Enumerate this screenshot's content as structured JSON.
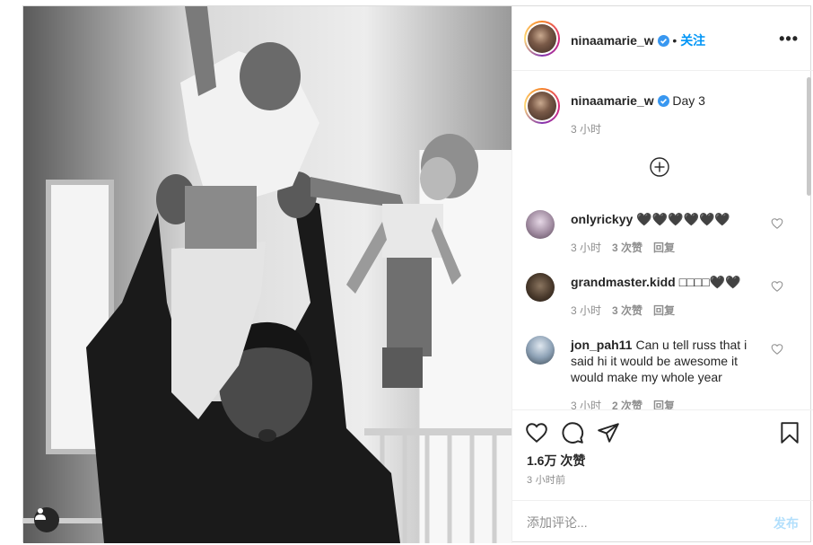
{
  "post": {
    "author": "ninaamarie_w",
    "follow_separator": "•",
    "follow_label": "关注",
    "more_label": "•••"
  },
  "caption": {
    "author": "ninaamarie_w",
    "text": "Day 3",
    "time": "3 小时"
  },
  "comments": [
    {
      "user": "onlyrickyy",
      "text": "🖤🖤🖤🖤🖤🖤",
      "time": "3 小时",
      "likes": "3 次赞",
      "reply": "回复"
    },
    {
      "user": "grandmaster.kidd",
      "text": "□□□□🖤🖤",
      "time": "3 小时",
      "likes": "3 次赞",
      "reply": "回复"
    },
    {
      "user": "jon_pah11",
      "text": "Can u tell russ that i said hi it would be awesome it would make my whole year",
      "time": "3 小时",
      "likes": "2 次赞",
      "reply": "回复"
    }
  ],
  "actions": {
    "likes": "1.6万 次赞",
    "posted_ago": "3 小时前"
  },
  "add_comment": {
    "placeholder": "添加评论...",
    "post_label": "发布"
  },
  "icons": {
    "like": "heart-icon",
    "comment": "comment-bubble-icon",
    "share": "paper-plane-icon",
    "save": "bookmark-icon",
    "tag": "user-tag-icon",
    "load_more": "plus-circle-icon",
    "verified": "verified-badge-icon"
  },
  "colors": {
    "accent": "#0095f6",
    "post_disabled": "#b2dffc",
    "muted": "#8e8e8e",
    "border": "#dbdbdb"
  }
}
